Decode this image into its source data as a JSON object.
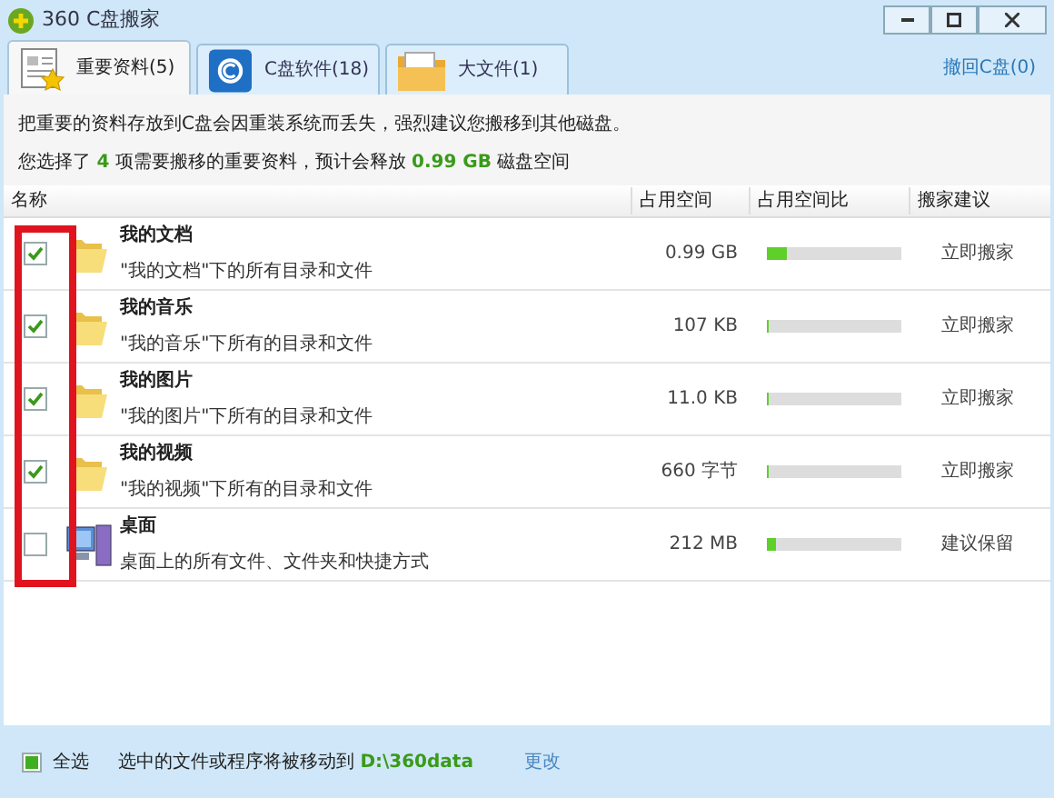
{
  "window": {
    "title": "360 C盘搬家"
  },
  "tabs": [
    {
      "label": "重要资料(5)",
      "selected": true,
      "kind": "documents"
    },
    {
      "label": "C盘软件(18)",
      "selected": false,
      "kind": "software"
    },
    {
      "label": "大文件(1)",
      "selected": false,
      "kind": "folder"
    }
  ],
  "restore_link": "撤回C盘(0)",
  "notice": "把重要的资料存放到C盘会因重装系统而丢失，强烈建议您搬移到其他磁盘。",
  "summary": "您选择了 **4** 项需要搬移的重要资料，预计会释放 **0.99 GB** 磁盘空间",
  "table": {
    "columns": [
      "名称",
      "占用空间",
      "占用空间比",
      "搬家建议"
    ],
    "rows": [
      {
        "kind": "folder",
        "checked": true,
        "name": "我的文档",
        "description": "\"我的文档\"下的所有目录和文件",
        "size": "0.99 GB",
        "level": 0.15,
        "advice": "立即搬家"
      },
      {
        "kind": "folder",
        "checked": true,
        "name": "我的音乐",
        "description": "\"我的音乐\"下所有的目录和文件",
        "size": "107 KB",
        "level": 0.01,
        "advice": "立即搬家"
      },
      {
        "kind": "folder",
        "checked": true,
        "name": "我的图片",
        "description": "\"我的图片\"下所有的目录和文件",
        "size": "11.0 KB",
        "level": 0.01,
        "advice": "立即搬家"
      },
      {
        "kind": "folder",
        "checked": true,
        "name": "我的视频",
        "description": "\"我的视频\"下所有的目录和文件",
        "size": "660 字节",
        "level": 0.01,
        "advice": "立即搬家"
      },
      {
        "kind": "desktop",
        "checked": false,
        "name": "桌面",
        "description": "桌面上的所有文件、文件夹和快捷方式",
        "size": "212 MB",
        "level": 0.07,
        "advice": "建议保留"
      }
    ]
  },
  "footer": {
    "select_all": {
      "label": "全选",
      "checked": true
    },
    "destination": "选中的文件或程序将被移动到 **D:\\360data**",
    "change_link": "更改"
  }
}
